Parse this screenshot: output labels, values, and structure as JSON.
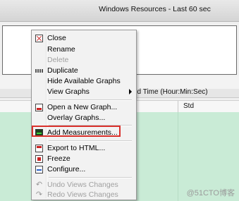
{
  "window": {
    "title": "Windows Resources - Last 60 sec",
    "elapsed_label": "ed Time (Hour:Min:Sec)",
    "table_column_std": "Std"
  },
  "context_menu": {
    "items": [
      {
        "label": "Close",
        "icon": "close-graph-icon",
        "enabled": true
      },
      {
        "label": "Rename",
        "icon": null,
        "enabled": true
      },
      {
        "label": "Delete",
        "icon": null,
        "enabled": false
      },
      {
        "label": "Duplicate",
        "icon": "duplicate-icon",
        "enabled": true
      },
      {
        "label": "Hide Available Graphs",
        "icon": null,
        "enabled": true
      },
      {
        "label": "View Graphs",
        "icon": null,
        "enabled": true,
        "submenu": true
      },
      {
        "label": "Open a New Graph...",
        "icon": "open-graph-icon",
        "enabled": true
      },
      {
        "label": "Overlay Graphs...",
        "icon": null,
        "enabled": true
      },
      {
        "label": "Add Measurements...",
        "icon": "add-measurements-icon",
        "enabled": true,
        "highlighted": true
      },
      {
        "label": "Export to HTML...",
        "icon": "export-icon",
        "enabled": true
      },
      {
        "label": "Freeze",
        "icon": "freeze-icon",
        "enabled": true
      },
      {
        "label": "Configure...",
        "icon": "configure-icon",
        "enabled": true
      },
      {
        "label": "Undo Views Changes",
        "icon": "undo-icon",
        "enabled": false
      },
      {
        "label": "Redo Views Changes",
        "icon": "redo-icon",
        "enabled": false
      }
    ]
  },
  "watermark": "@51CTO博客",
  "colors": {
    "table_background": "#c9ebd6",
    "highlight_border": "#d9302b",
    "menu_background": "#f2f2f2"
  }
}
